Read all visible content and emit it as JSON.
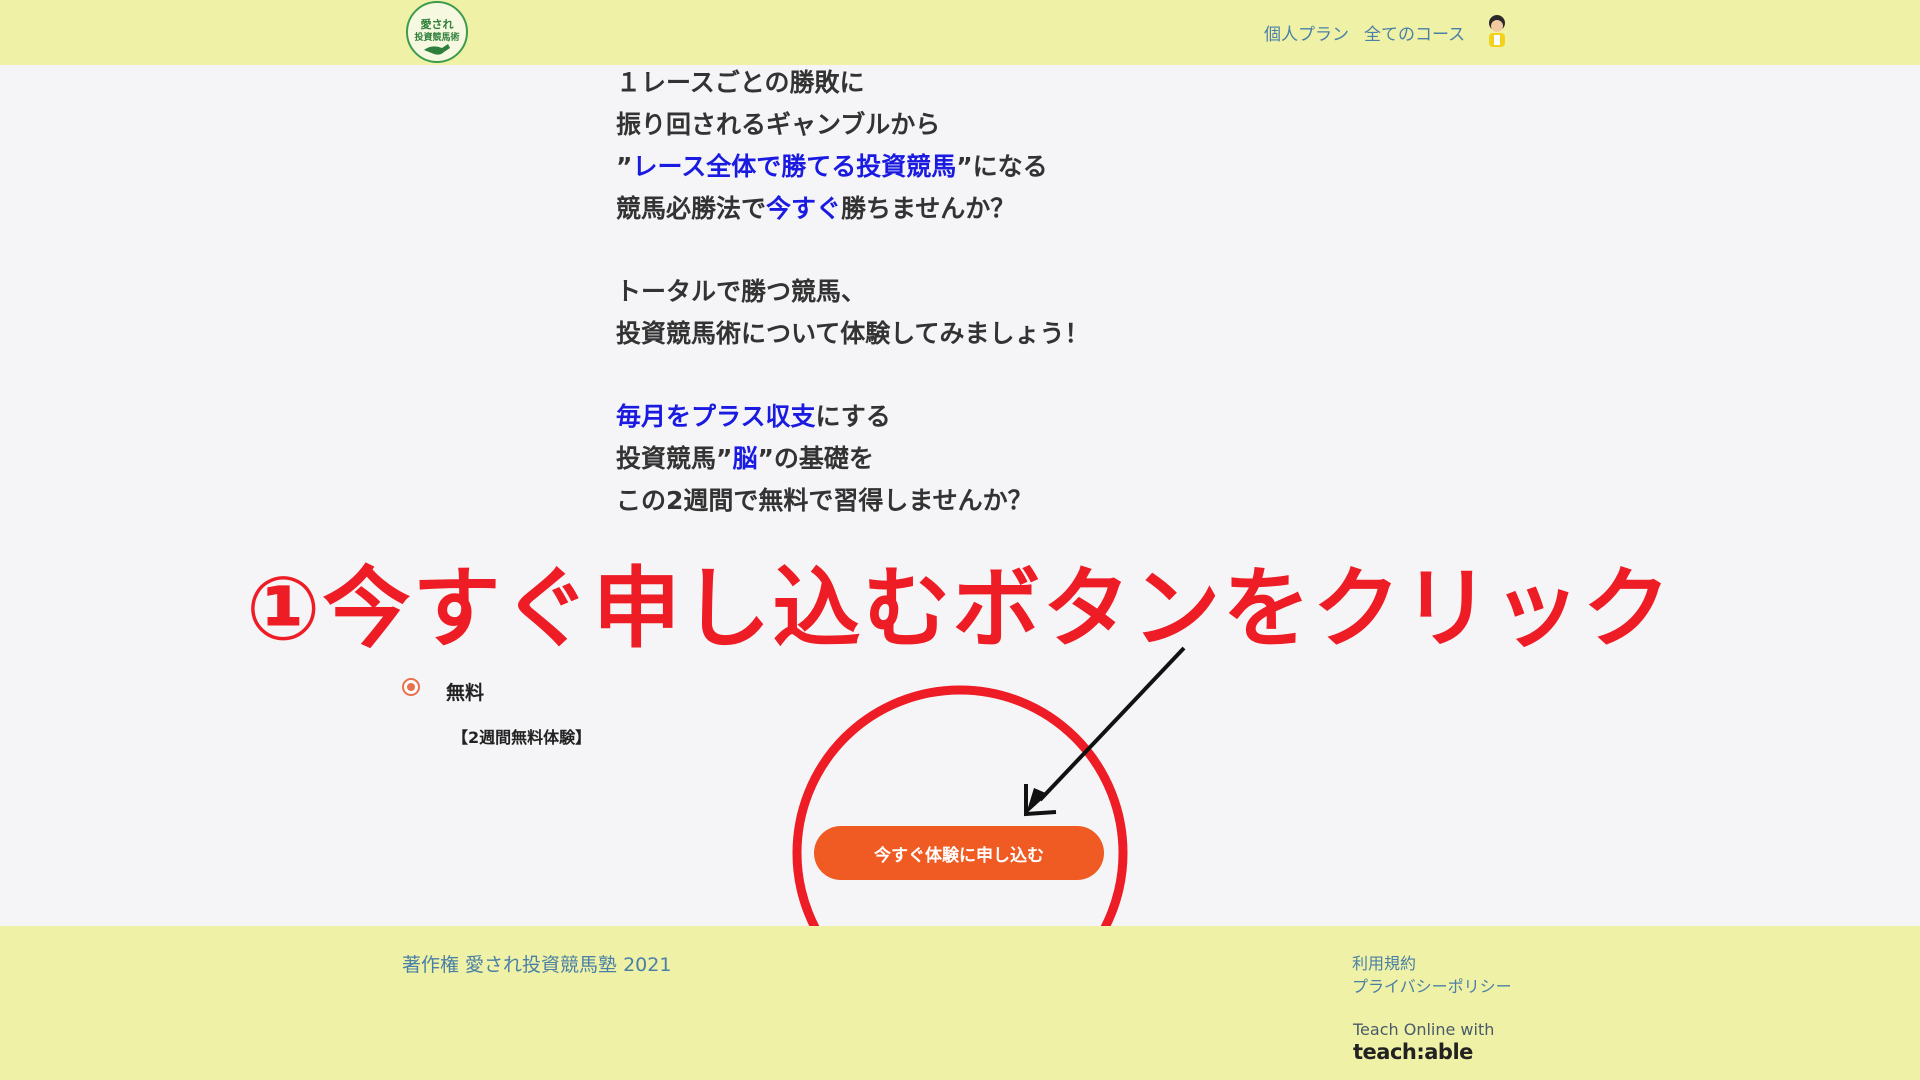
{
  "header": {
    "logo_text": "愛され投資競馬術",
    "nav": {
      "plan": "個人プラン",
      "courses": "全てのコース"
    }
  },
  "intro": {
    "l1": "１レースごとの勝敗に",
    "l2": "振り回されるギャンブルから",
    "l3a": "”",
    "l3b": "レース全体で勝てる投資競馬",
    "l3c": "”になる",
    "l4a": "競馬必勝法で",
    "l4b": "今すぐ",
    "l4c": "勝ちませんか？",
    "l5": "トータルで勝つ競馬、",
    "l6": "投資競馬術について体験してみましょう！",
    "l7a": "毎月をプラス収支",
    "l7b": "にする",
    "l8a": "投資競馬”",
    "l8b": "脳",
    "l8c": "”の基礎を",
    "l9": "この2週間で無料で習得しませんか？"
  },
  "annotation": "①今すぐ申し込むボタンをクリック",
  "plan": {
    "label": "無料",
    "sub": "【2週間無料体験】",
    "selected": true
  },
  "cta": {
    "label": "今すぐ体験に申し込む"
  },
  "footer": {
    "copyright": "著作権 愛され投資競馬塾 2021",
    "terms": "利用規約",
    "privacy": "プライバシーポリシー",
    "teach_with": "Teach Online with",
    "teach_logo": "teach:able"
  },
  "colors": {
    "header_bg": "#eff2a6",
    "accent_blue": "#1a1ae0",
    "cta": "#ef5b23",
    "annotation_red": "#ee1c25"
  }
}
